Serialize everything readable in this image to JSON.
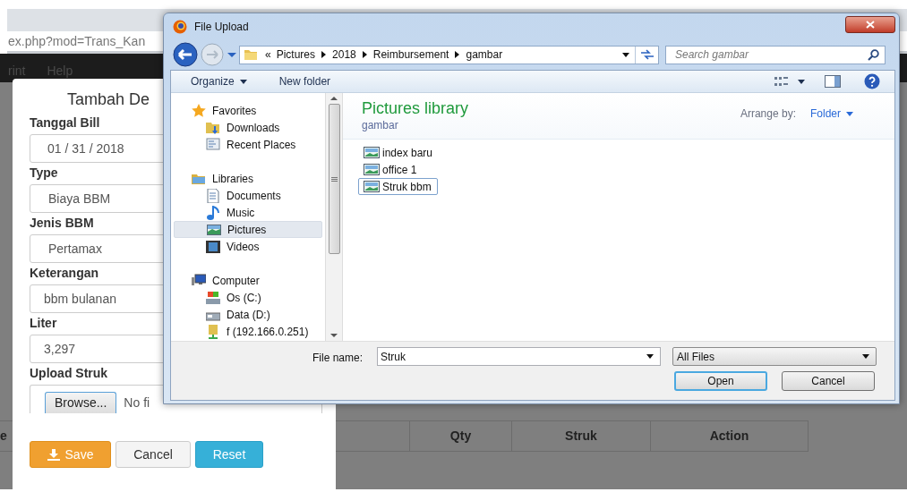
{
  "browser": {
    "url": "ex.php?mod=Trans_Kan",
    "menu": [
      "rint",
      "Help"
    ]
  },
  "modal": {
    "title": "Tambah De",
    "fields": [
      {
        "label": "Tanggal Bill",
        "kind": "date",
        "value": "01 / 31 / 2018"
      },
      {
        "label": "Type",
        "kind": "select",
        "value": "Biaya BBM"
      },
      {
        "label": "Jenis BBM",
        "kind": "select",
        "value": "Pertamax"
      },
      {
        "label": "Keterangan",
        "kind": "text",
        "value": "bbm bulanan"
      },
      {
        "label": "Liter",
        "kind": "text",
        "value": "3,297"
      },
      {
        "label": "Upload Struk",
        "kind": "file",
        "button": "Browse...",
        "value": "No fi"
      }
    ],
    "buttons": [
      {
        "label": "Save",
        "kind": "primary"
      },
      {
        "label": "Cancel",
        "kind": "default"
      },
      {
        "label": "Reset",
        "kind": "info"
      }
    ]
  },
  "table": {
    "columns": [
      "e",
      "Qty",
      "Struk",
      "Action"
    ]
  },
  "dialog": {
    "title": "File Upload",
    "breadcrumb_overflow": "«",
    "breadcrumb": [
      "Pictures",
      "2018",
      "Reimbursement",
      "gambar"
    ],
    "search": {
      "placeholder": "Search gambar"
    },
    "toolbar": [
      "Organize",
      "New folder"
    ],
    "nav": [
      {
        "label": "Favorites",
        "selected": false,
        "children": [
          {
            "label": "Downloads",
            "selected": false
          },
          {
            "label": "Recent Places",
            "selected": false
          }
        ]
      },
      {
        "label": "Libraries",
        "selected": false,
        "children": [
          {
            "label": "Documents",
            "selected": false
          },
          {
            "label": "Music",
            "selected": false
          },
          {
            "label": "Pictures",
            "selected": true
          },
          {
            "label": "Videos",
            "selected": false
          }
        ]
      },
      {
        "label": "Computer",
        "selected": false,
        "children": [
          {
            "label": "Os (C:)",
            "selected": false
          },
          {
            "label": "Data (D:)",
            "selected": false
          },
          {
            "label": "f (192.166.0.251)",
            "selected": false
          }
        ]
      }
    ],
    "library": {
      "title": "Pictures library",
      "subtitle": "gambar",
      "arrange_label": "Arrange by:",
      "arrange_value": "Folder"
    },
    "files": [
      {
        "name": "index baru",
        "selected": false
      },
      {
        "name": "office 1",
        "selected": false
      },
      {
        "name": "Struk bbm",
        "selected": true
      }
    ],
    "file_name": {
      "label": "File name:",
      "value": "Struk"
    },
    "filter": "All Files",
    "buttons": [
      "Open",
      "Cancel"
    ]
  }
}
